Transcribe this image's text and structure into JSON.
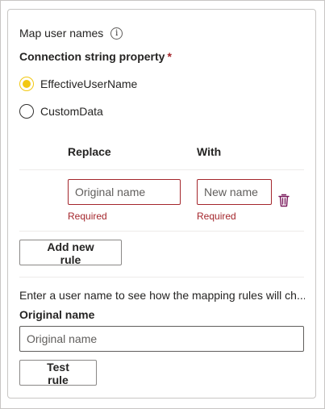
{
  "section": {
    "title": "Map user names",
    "info_icon": "info-icon",
    "property_label": "Connection string property",
    "required_marker": "*"
  },
  "radios": {
    "options": [
      {
        "label": "EffectiveUserName",
        "checked": true
      },
      {
        "label": "CustomData",
        "checked": false
      }
    ]
  },
  "rules": {
    "columns": {
      "replace": "Replace",
      "with": "With"
    },
    "row": {
      "original_placeholder": "Original name",
      "new_placeholder": "New name",
      "original_error": "Required",
      "new_error": "Required",
      "delete_icon": "trash-icon"
    },
    "add_button": "Add new rule"
  },
  "test": {
    "description": "Enter a user name to see how the mapping rules will ch...",
    "label": "Original name",
    "placeholder": "Original name",
    "button": "Test rule"
  },
  "colors": {
    "accent": "#f2c811",
    "error": "#a4262c",
    "border": "#c8c6c4"
  }
}
